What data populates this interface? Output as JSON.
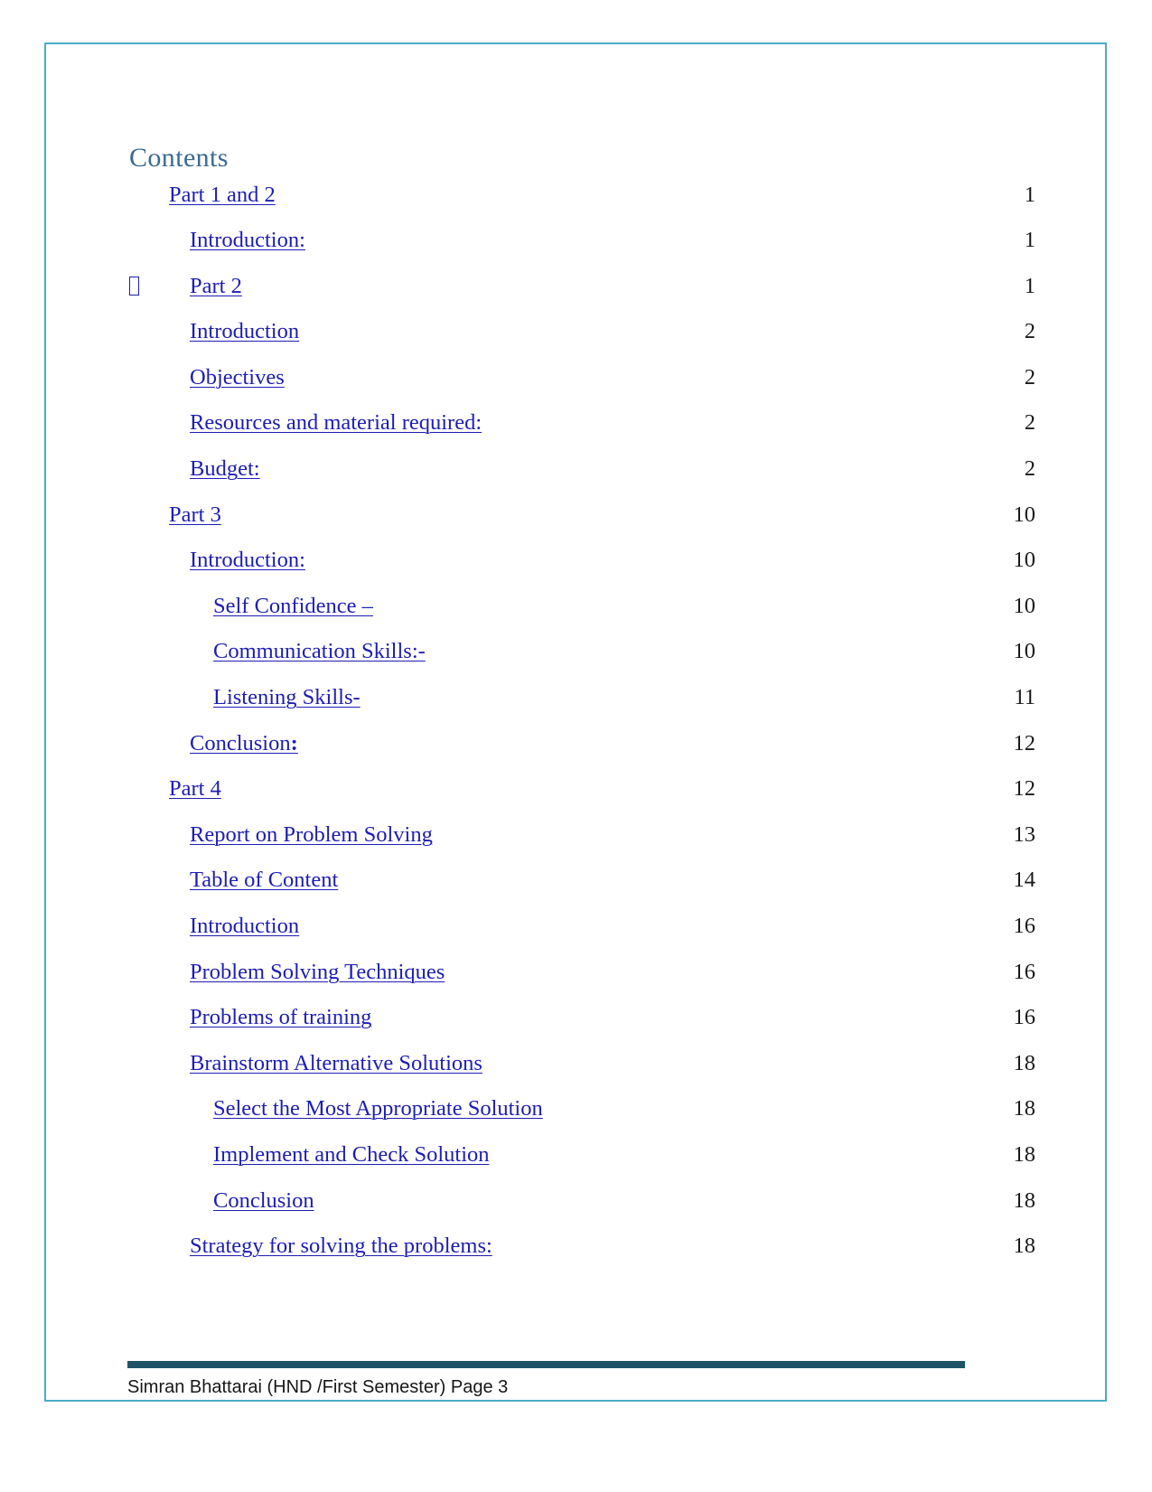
{
  "document": {
    "heading": "Contents",
    "page_border_color": "#4BACC6",
    "link_color": "#1D1DB5",
    "heading_color": "#3B6A93",
    "footer_bar_color": "#1F5468"
  },
  "toc": {
    "entries": [
      {
        "label": "Part 1 and 2",
        "page": "1",
        "level": 0,
        "bullet": ""
      },
      {
        "label": "Introduction:",
        "page": "1",
        "level": 1,
        "bullet": ""
      },
      {
        "label": "Part 2",
        "page": "1",
        "level": 1,
        "bullet": "tofu-box-glyph"
      },
      {
        "label": "Introduction",
        "page": "2",
        "level": 1,
        "bullet": ""
      },
      {
        "label": "Objectives",
        "page": "2",
        "level": 1,
        "bullet": ""
      },
      {
        "label": "Resources and material required:",
        "page": "2",
        "level": 1,
        "bullet": ""
      },
      {
        "label": "Budget:",
        "page": "2",
        "level": 1,
        "bullet": ""
      },
      {
        "label": "Part 3",
        "page": "10",
        "level": 0,
        "bullet": ""
      },
      {
        "label": "Introduction:",
        "page": "10",
        "level": 1,
        "bullet": ""
      },
      {
        "label": "Self Confidence –",
        "page": "10",
        "level": 2,
        "bullet": ""
      },
      {
        "label": "Communication Skills:-",
        "page": "10",
        "level": 2,
        "bullet": ""
      },
      {
        "label": "Listening Skills-",
        "page": "11",
        "level": 2,
        "bullet": ""
      },
      {
        "label": "Conclusion:",
        "page": "12",
        "level": 1,
        "bullet": "",
        "bold_tail": ":"
      },
      {
        "label": "Part 4",
        "page": "12",
        "level": 0,
        "bullet": ""
      },
      {
        "label": "Report on Problem Solving",
        "page": "13",
        "level": 1,
        "bullet": ""
      },
      {
        "label": "Table of Content",
        "page": "14",
        "level": 1,
        "bullet": ""
      },
      {
        "label": "Introduction",
        "page": "16",
        "level": 1,
        "bullet": ""
      },
      {
        "label": "Problem Solving Techniques",
        "page": "16",
        "level": 1,
        "bullet": ""
      },
      {
        "label": "Problems of training",
        "page": "16",
        "level": 1,
        "bullet": ""
      },
      {
        "label": "Brainstorm Alternative Solutions",
        "page": "18",
        "level": 1,
        "bullet": ""
      },
      {
        "label": "Select the Most Appropriate Solution",
        "page": "18",
        "level": 2,
        "bullet": ""
      },
      {
        "label": "Implement and Check Solution",
        "page": "18",
        "level": 2,
        "bullet": ""
      },
      {
        "label": "Conclusion",
        "page": "18",
        "level": 2,
        "bullet": ""
      },
      {
        "label": "Strategy for solving the problems:",
        "page": "18",
        "level": 1,
        "bullet": ""
      }
    ]
  },
  "footer": {
    "text": "Simran Bhattarai (HND /First Semester) Page 3"
  }
}
